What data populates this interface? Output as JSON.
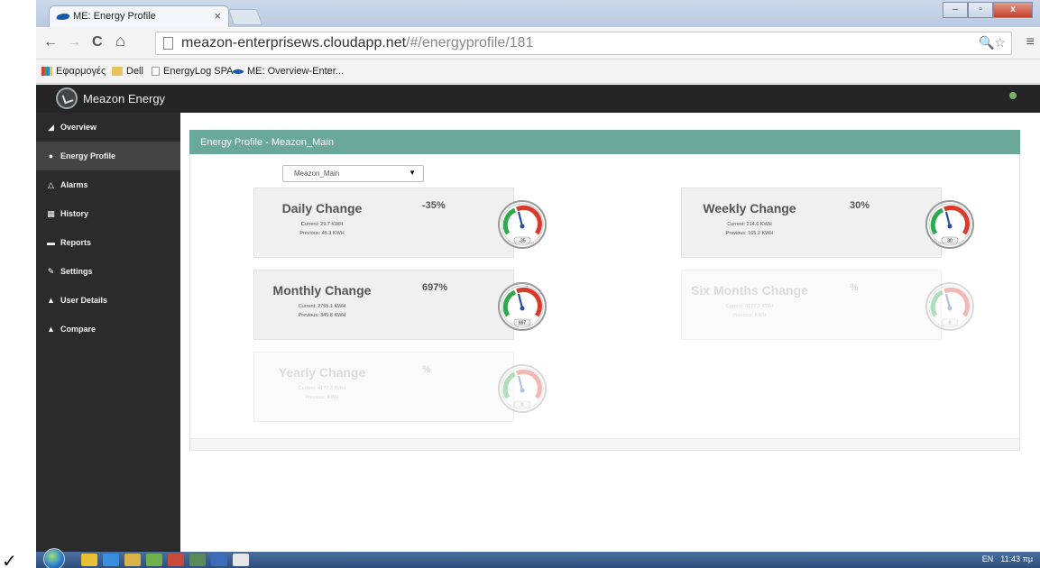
{
  "browser": {
    "tab_title": "ME: Energy Profile",
    "tab_close": "×",
    "url_host": "meazon-enterprisews.cloudapp.net",
    "url_path": "/#/energyprofile/181",
    "back": "←",
    "forward": "→",
    "reload": "C",
    "home": "⌂",
    "zoom_star": "🔍☆",
    "menu": "≡",
    "window_min": "–",
    "window_max": "▫",
    "window_close": "x"
  },
  "bookmarks": [
    {
      "label": "Εφαρμογές",
      "icon": "apps-icon"
    },
    {
      "label": "Dell",
      "icon": "folder-icon"
    },
    {
      "label": "EnergyLog SPA",
      "icon": "page-icon"
    },
    {
      "label": "ME: Overview-Enter...",
      "icon": "bird-icon"
    }
  ],
  "app": {
    "brand": "Meazon Energy"
  },
  "sidebar": {
    "items": [
      {
        "label": "Overview",
        "icon": "chart-icon",
        "glyph": "◢"
      },
      {
        "label": "Energy Profile",
        "icon": "group-icon",
        "glyph": "●"
      },
      {
        "label": "Alarms",
        "icon": "alert-icon",
        "glyph": "△"
      },
      {
        "label": "History",
        "icon": "calendar-icon",
        "glyph": "▦"
      },
      {
        "label": "Reports",
        "icon": "folder-icon",
        "glyph": "▬"
      },
      {
        "label": "Settings",
        "icon": "wrench-icon",
        "glyph": "✎"
      },
      {
        "label": "User Details",
        "icon": "user-icon",
        "glyph": "▲"
      },
      {
        "label": "Compare",
        "icon": "user-icon",
        "glyph": "▲"
      }
    ],
    "active_index": 1
  },
  "panel": {
    "title": "Energy Profile - Meazon_Main",
    "select_value": "Meazon_Main",
    "select_arrow": "▼"
  },
  "cards": {
    "daily": {
      "title": "Daily Change",
      "pct": "-35%",
      "current": "Current: 29.7 KWH",
      "previous": "Previous: 45.3 KWH",
      "gauge_label": "-35"
    },
    "weekly": {
      "title": "Weekly Change",
      "pct": "30%",
      "current": "Current: 214.6 KWH",
      "previous": "Previous: 165.2 KWH",
      "gauge_label": "30"
    },
    "monthly": {
      "title": "Monthly Change",
      "pct": "697%",
      "current": "Current: 2755.1 KWH",
      "previous": "Previous: 345.8 KWH",
      "gauge_label": "697"
    },
    "six_months": {
      "title": "Six Months Change",
      "pct": "%",
      "current": "Current: 4177.3 KWH",
      "previous": "Previous: KWH",
      "gauge_label": "0"
    },
    "yearly": {
      "title": "Yearly Change",
      "pct": "%",
      "current": "Current: 4177.3 KWH",
      "previous": "Previous: KWH",
      "gauge_label": "0"
    }
  },
  "taskbar": {
    "lang": "EN",
    "time": "11:43 πμ"
  },
  "overlay": {
    "checkmark": "✓"
  }
}
